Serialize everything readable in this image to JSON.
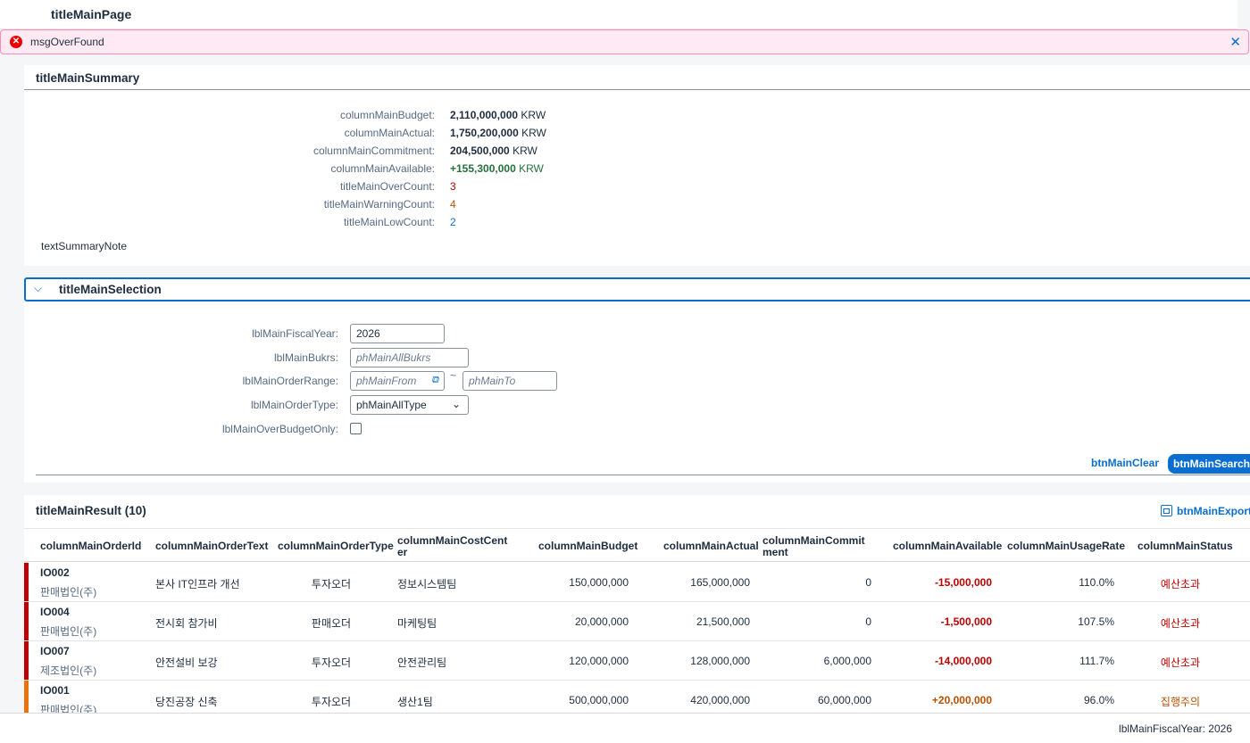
{
  "page": {
    "title": "titleMainPage"
  },
  "message": {
    "text": "msgOverFound",
    "type": "error"
  },
  "summary": {
    "title": "titleMainSummary",
    "rows": [
      {
        "label": "columnMainBudget:",
        "value": "2,110,000,000",
        "unit": "KRW",
        "color": "#1d2d3e"
      },
      {
        "label": "columnMainActual:",
        "value": "1,750,200,000",
        "unit": "KRW",
        "color": "#1d2d3e"
      },
      {
        "label": "columnMainCommitment:",
        "value": "204,500,000",
        "unit": "KRW",
        "color": "#1d2d3e"
      },
      {
        "label": "columnMainAvailable:",
        "value": "+155,300,000",
        "unit": "KRW",
        "color": "#256f3a"
      },
      {
        "label": "titleMainOverCount:",
        "value": "3",
        "unit": "",
        "color": "#bb0000"
      },
      {
        "label": "titleMainWarningCount:",
        "value": "4",
        "unit": "",
        "color": "#b95000"
      },
      {
        "label": "titleMainLowCount:",
        "value": "2",
        "unit": "",
        "color": "#0a6ed1"
      }
    ],
    "note": "textSummaryNote"
  },
  "selection": {
    "title": "titleMainSelection",
    "fiscal_year_label": "lblMainFiscalYear:",
    "fiscal_year_value": "2026",
    "bukrs_label": "lblMainBukrs:",
    "bukrs_placeholder": "phMainAllBukrs",
    "order_range_label": "lblMainOrderRange:",
    "order_from_placeholder": "phMainFrom",
    "order_to_placeholder": "phMainTo",
    "range_separator": "~",
    "order_type_label": "lblMainOrderType:",
    "order_type_value": "phMainAllType",
    "over_budget_label": "lblMainOverBudgetOnly:",
    "over_budget_checked": false,
    "clear_label": "btnMainClear",
    "search_label": "btnMainSearch"
  },
  "result": {
    "title": "titleMainResult (10)",
    "export_label": "btnMainExportC",
    "columns": [
      "columnMainOrderId",
      "columnMainOrderText",
      "columnMainOrderType",
      "columnMainCostCenter",
      "columnMainBudget",
      "columnMainActual",
      "columnMainCommitment",
      "columnMainAvailable",
      "columnMainUsageRate",
      "columnMainStatus"
    ],
    "rows": [
      {
        "id": "IO002",
        "company": "판매법인(주)",
        "text": "본사 IT인프라 개선",
        "type": "투자오더",
        "cost_center": "정보시스템팀",
        "budget": "150,000,000",
        "actual": "165,000,000",
        "commitment": "0",
        "available": "-15,000,000",
        "usage": "110.0%",
        "status": "예산초과",
        "level": "over"
      },
      {
        "id": "IO004",
        "company": "판매법인(주)",
        "text": "전시회 참가비",
        "type": "판매오더",
        "cost_center": "마케팅팀",
        "budget": "20,000,000",
        "actual": "21,500,000",
        "commitment": "0",
        "available": "-1,500,000",
        "usage": "107.5%",
        "status": "예산초과",
        "level": "over"
      },
      {
        "id": "IO007",
        "company": "제조법인(주)",
        "text": "안전설비 보강",
        "type": "투자오더",
        "cost_center": "안전관리팀",
        "budget": "120,000,000",
        "actual": "128,000,000",
        "commitment": "6,000,000",
        "available": "-14,000,000",
        "usage": "111.7%",
        "status": "예산초과",
        "level": "over"
      },
      {
        "id": "IO001",
        "company": "판매법인(주)",
        "text": "당진공장 신축",
        "type": "투자오더",
        "cost_center": "생산1팀",
        "budget": "500,000,000",
        "actual": "420,000,000",
        "commitment": "60,000,000",
        "available": "+20,000,000",
        "usage": "96.0%",
        "status": "집행주의",
        "level": "warning"
      }
    ]
  },
  "colors": {
    "over": "#bb0000",
    "warning": "#e9730c",
    "accent": "#0a6ed1"
  },
  "status_bar": {
    "text": "lblMainFiscalYear: 2026"
  }
}
